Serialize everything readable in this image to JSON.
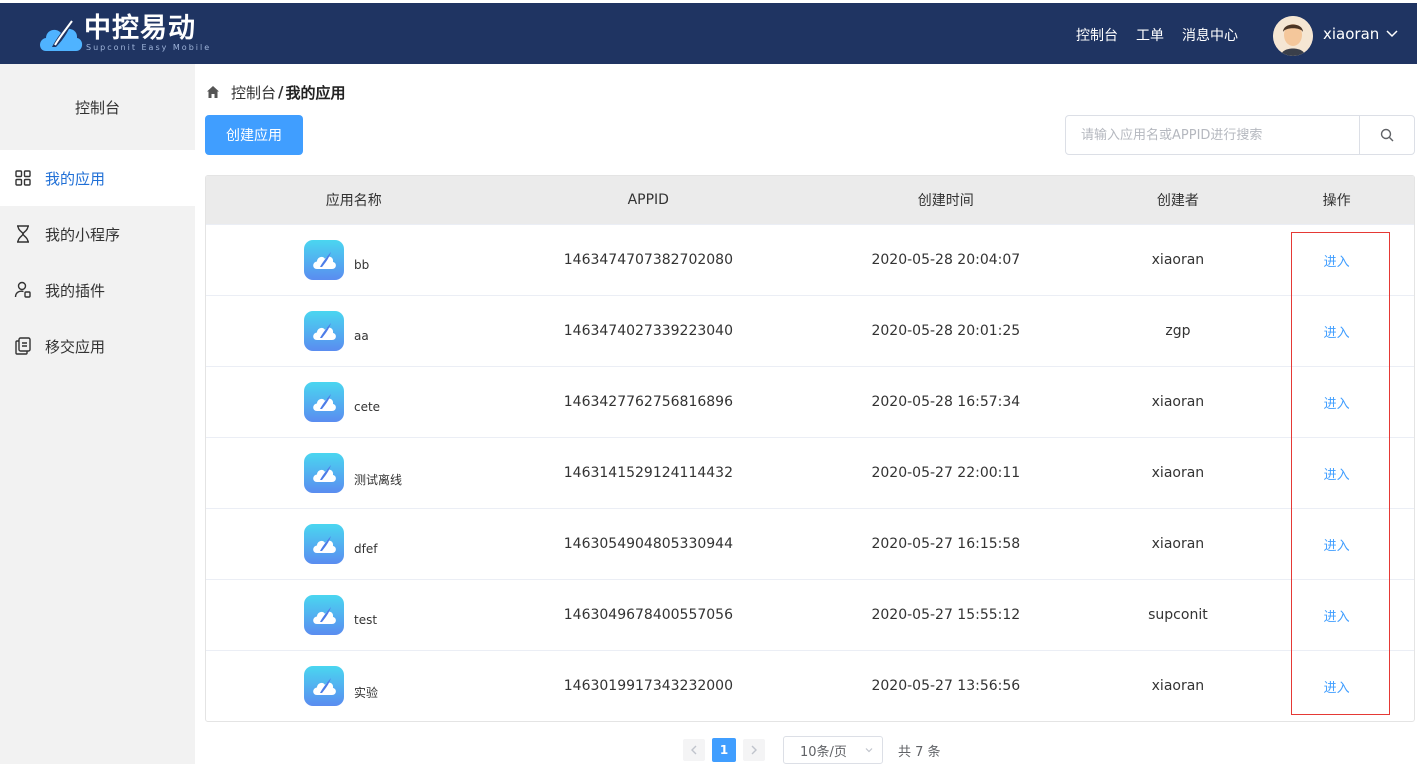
{
  "header": {
    "logo_cn": "中控易动",
    "logo_en": "Supconit Easy Mobile",
    "nav": [
      "控制台",
      "工单",
      "消息中心"
    ],
    "username": "xiaoran"
  },
  "sidebar": {
    "console_label": "控制台",
    "items": [
      {
        "label": "我的应用",
        "icon": "grid-icon"
      },
      {
        "label": "我的小程序",
        "icon": "hourglass-icon"
      },
      {
        "label": "我的插件",
        "icon": "user-plugin-icon"
      },
      {
        "label": "移交应用",
        "icon": "transfer-doc-icon"
      }
    ]
  },
  "breadcrumb": {
    "root": "控制台",
    "separator": "/",
    "current": "我的应用"
  },
  "toolbar": {
    "create_label": "创建应用",
    "search_placeholder": "请输入应用名或APPID进行搜索"
  },
  "table": {
    "columns": [
      "应用名称",
      "APPID",
      "创建时间",
      "创建者",
      "操作"
    ],
    "rows": [
      {
        "name": "bb",
        "appid": "1463474707382702080",
        "created": "2020-05-28 20:04:07",
        "creator": "xiaoran",
        "action": "进入"
      },
      {
        "name": "aa",
        "appid": "1463474027339223040",
        "created": "2020-05-28 20:01:25",
        "creator": "zgp",
        "action": "进入"
      },
      {
        "name": "cete",
        "appid": "1463427762756816896",
        "created": "2020-05-28 16:57:34",
        "creator": "xiaoran",
        "action": "进入"
      },
      {
        "name": "测试离线",
        "appid": "1463141529124114432",
        "created": "2020-05-27 22:00:11",
        "creator": "xiaoran",
        "action": "进入"
      },
      {
        "name": "dfef",
        "appid": "1463054904805330944",
        "created": "2020-05-27 16:15:58",
        "creator": "xiaoran",
        "action": "进入"
      },
      {
        "name": "test",
        "appid": "1463049678400557056",
        "created": "2020-05-27 15:55:12",
        "creator": "supconit",
        "action": "进入"
      },
      {
        "name": "实验",
        "appid": "1463019917343232000",
        "created": "2020-05-27 13:56:56",
        "creator": "xiaoran",
        "action": "进入"
      }
    ]
  },
  "pagination": {
    "current_page": "1",
    "page_size": "10条/页",
    "total": "共 7 条"
  },
  "colors": {
    "header_bg": "#1f3462",
    "accent": "#409eff",
    "sidebar_bg": "#f2f2f2",
    "highlight": "#e53935"
  }
}
